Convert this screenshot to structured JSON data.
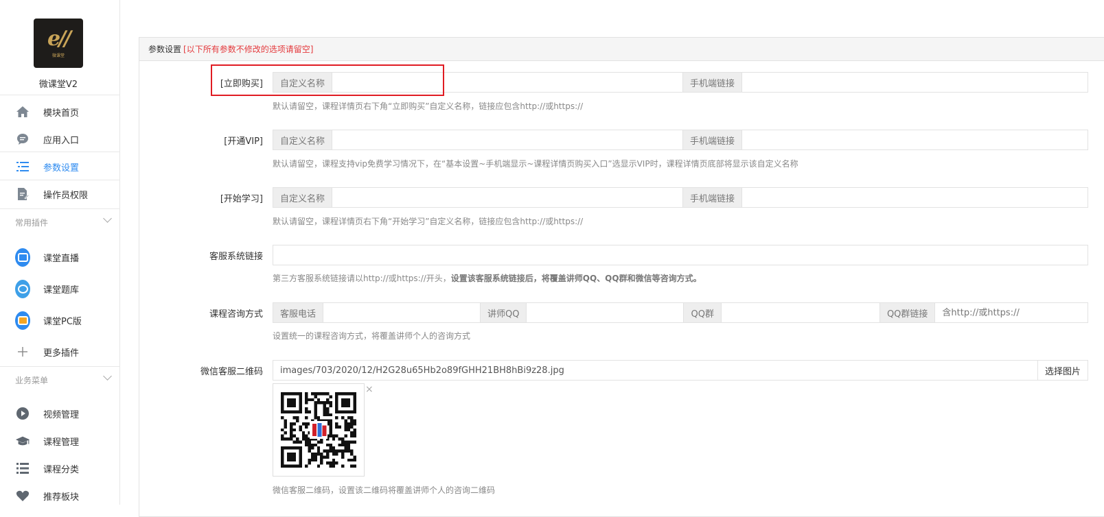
{
  "app": {
    "name": "微课堂V2",
    "logo_text": "微课堂"
  },
  "sidebar": {
    "items": [
      {
        "label": "模块首页"
      },
      {
        "label": "应用入口"
      },
      {
        "label": "参数设置"
      },
      {
        "label": "操作员权限"
      }
    ],
    "plugins_title": "常用插件",
    "plugins": [
      {
        "label": "课堂直播",
        "color": "#2e8bf0"
      },
      {
        "label": "课堂题库",
        "color": "#3ea0e8"
      },
      {
        "label": "课堂PC版",
        "color": "#2e8bf0"
      },
      {
        "label": "更多插件"
      }
    ],
    "business_title": "业务菜单",
    "business": [
      {
        "label": "视频管理"
      },
      {
        "label": "课程管理"
      },
      {
        "label": "课程分类"
      },
      {
        "label": "推荐板块"
      }
    ]
  },
  "panel": {
    "title": "参数设置",
    "notice": "[以下所有参数不修改的选项请留空]"
  },
  "form": {
    "buy_now": {
      "label": "[立即购买]",
      "name_addon": "自定义名称",
      "link_addon": "手机端链接",
      "name_value": "",
      "link_value": "",
      "help": "默认请留空，课程详情页右下角“立即购买”自定义名称，链接应包含http://或https://"
    },
    "open_vip": {
      "label": "[开通VIP]",
      "name_addon": "自定义名称",
      "link_addon": "手机端链接",
      "name_value": "",
      "link_value": "",
      "help": "默认请留空，课程支持vip免费学习情况下，在“基本设置~手机端显示~课程详情页购买入口”选显示VIP时，课程详情页底部将显示该自定义名称"
    },
    "start_study": {
      "label": "[开始学习]",
      "name_addon": "自定义名称",
      "link_addon": "手机端链接",
      "name_value": "",
      "link_value": "",
      "help": "默认请留空，课程详情页右下角“开始学习”自定义名称，链接应包含http://或https://"
    },
    "service_link": {
      "label": "客服系统链接",
      "value": "",
      "help_plain": "第三方客服系统链接请以http://或https://开头，",
      "help_bold": "设置该客服系统链接后，将覆盖讲师QQ、QQ群和微信等咨询方式。"
    },
    "consult": {
      "label": "课程咨询方式",
      "phone_addon": "客服电话",
      "qq_addon": "讲师QQ",
      "qqgroup_addon": "QQ群",
      "qqgroup_link_addon": "QQ群链接",
      "qqgroup_link_placeholder": "含http://或https://",
      "help": "设置统一的课程咨询方式，将覆盖讲师个人的咨询方式"
    },
    "wechat_qr": {
      "label": "微信客服二维码",
      "value": "images/703/2020/12/H2G28u65Hb2o89fGHH21BH8hBi9z28.jpg",
      "button": "选择图片",
      "close": "×",
      "help": "微信客服二维码，设置该二维码将覆盖讲师个人的咨询二维码"
    }
  }
}
